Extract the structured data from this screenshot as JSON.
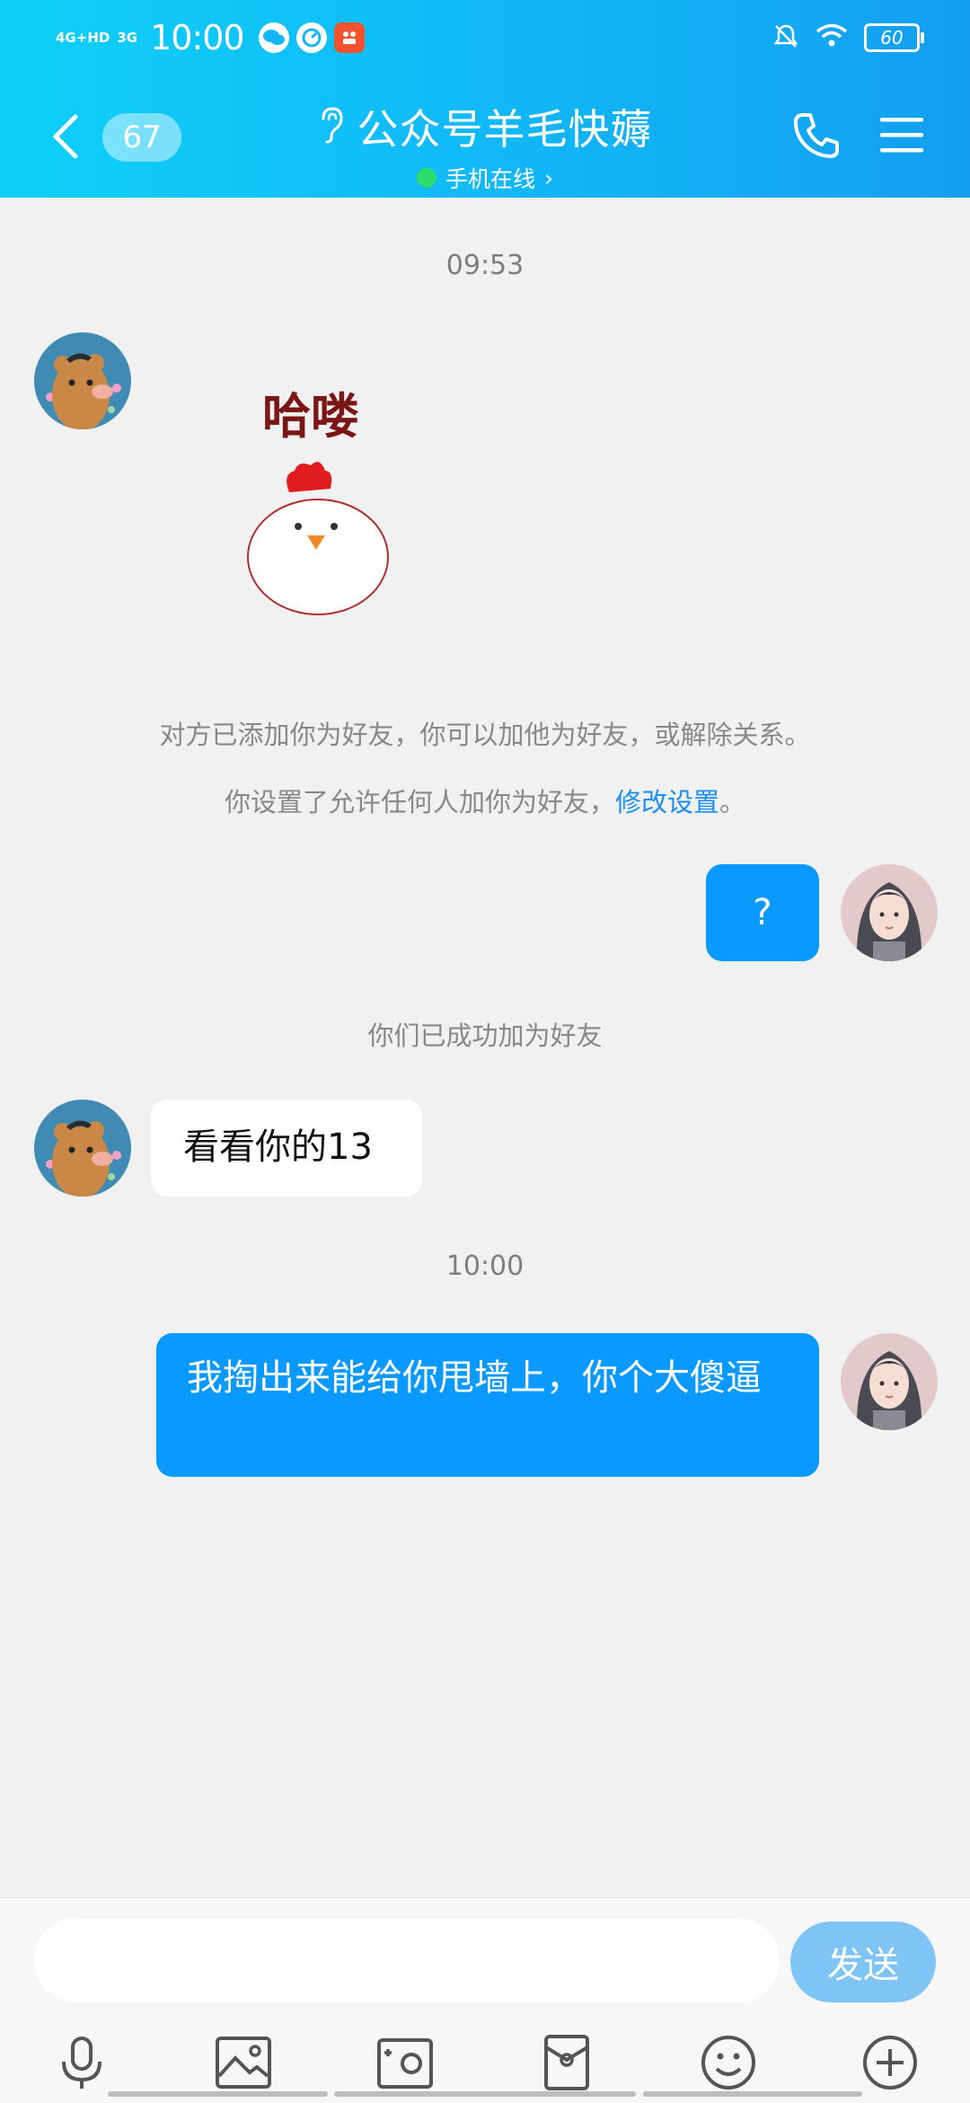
{
  "status_bar": {
    "network_1": "4G+HD",
    "network_2": "3G",
    "time": "10:00",
    "battery": "60",
    "icons": [
      "wechat-icon",
      "speed-icon",
      "taobao-icon",
      "mute-icon",
      "wifi-icon",
      "battery-icon"
    ]
  },
  "header": {
    "back_badge": "67",
    "title": "公众号羊毛快薅",
    "subtitle": "手机在线",
    "subtitle_arrow": "›",
    "icons": [
      "back-icon",
      "ear-icon",
      "phone-icon",
      "menu-icon"
    ]
  },
  "chat": {
    "timestamp_1": "09:53",
    "sticker_text": "哈喽",
    "system_1": "对方已添加你为好友，你可以加他为好友，或解除关系。",
    "system_2_prefix": "你设置了允许任何人加你为好友，",
    "system_2_link": "修改设置",
    "system_2_suffix": "。",
    "msg_question": "?",
    "system_3": "你们已成功加为好友",
    "msg_in_1": "看看你的13",
    "timestamp_2": "10:00",
    "msg_out_2": "我掏出来能给你甩墙上，你个大傻逼"
  },
  "input": {
    "placeholder": "",
    "send_label": "发送",
    "tools": [
      "mic-icon",
      "photo-icon",
      "camera-icon",
      "red-packet-icon",
      "emoji-icon",
      "plus-icon"
    ]
  },
  "colors": {
    "header_start": "#0fd0f8",
    "header_end": "#139ef0",
    "bubble_out": "#0a99ff",
    "link": "#1d8ff0",
    "send_button": "#7ec4f5"
  }
}
